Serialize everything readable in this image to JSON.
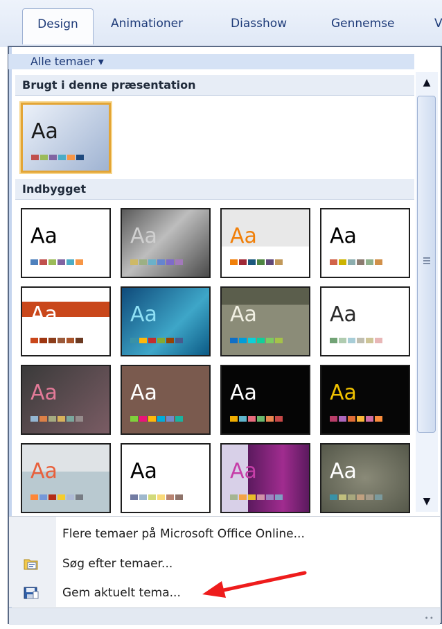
{
  "tabs": [
    {
      "label": "Design",
      "active": true
    },
    {
      "label": "Animationer",
      "active": false
    },
    {
      "label": "Diasshow",
      "active": false
    },
    {
      "label": "Gennemse",
      "active": false
    },
    {
      "label": "V",
      "active": false
    }
  ],
  "filter": {
    "label": "Alle temaer ▾"
  },
  "sections": {
    "used": "Brugt i denne præsentation",
    "builtin": "Indbygget"
  },
  "thumb_text": "Aa",
  "themes_used": [
    {
      "name": "current-theme",
      "bg": "linear-gradient(135deg,#ecf1f9,#9fb3d2)",
      "aa": "#1a1a1a",
      "swatches": [
        "#c0504d",
        "#9bbb59",
        "#8064a2",
        "#4bacc6",
        "#f79646",
        "#1f497d"
      ],
      "selected": true
    }
  ],
  "themes_builtin": [
    {
      "name": "office",
      "bg": "#ffffff",
      "aa": "#000000",
      "swatches": [
        "#4f81bd",
        "#c0504d",
        "#9bbb59",
        "#8064a2",
        "#4bacc6",
        "#f79646"
      ]
    },
    {
      "name": "apex",
      "bg": "linear-gradient(135deg,#5a5a5a,#bdbdbd 45%,#4a4a4a)",
      "aa": "#d0d0d0",
      "swatches": [
        "#ceb966",
        "#9cb084",
        "#6bb1c9",
        "#6585cf",
        "#7e6bc9",
        "#a379bb"
      ]
    },
    {
      "name": "aspect",
      "bg": "linear-gradient(#e8e8e8 55%,#ffffff 55%)",
      "aa": "#f07f09",
      "swatches": [
        "#f07f09",
        "#9f2936",
        "#1b587c",
        "#4e8542",
        "#604878",
        "#c19859"
      ]
    },
    {
      "name": "civic",
      "bg": "#ffffff",
      "aa": "#000000",
      "swatches": [
        "#d16349",
        "#ccb400",
        "#8cadae",
        "#8c7b70",
        "#8fb08c",
        "#d19049"
      ]
    },
    {
      "name": "concourse",
      "bg": "#ffffff",
      "aa": "#ffffff",
      "swatches": [
        "#c9471b",
        "#9e3611",
        "#8c3d1a",
        "#9b5a3a",
        "#a9542b",
        "#6b3a22"
      ],
      "band": "#c9471b"
    },
    {
      "name": "equity",
      "bg": "linear-gradient(135deg,#0f4a7a,#3ea6c8 60%,#0c5a85)",
      "aa": "#8fe0f5",
      "swatches": [
        "#3891a7",
        "#feb80a",
        "#c32d2e",
        "#84aa33",
        "#964305",
        "#475a8d"
      ]
    },
    {
      "name": "flow",
      "bg": "linear-gradient(#5b5e4c 25%,#8b8c78 25%)",
      "aa": "#f0efe2",
      "swatches": [
        "#0f6fc6",
        "#009dd9",
        "#0bd0d9",
        "#10cf9b",
        "#7cca62",
        "#a5c249"
      ]
    },
    {
      "name": "foundry",
      "bg": "#ffffff",
      "aa": "#2b2b2b",
      "swatches": [
        "#72a376",
        "#b0ccb0",
        "#a8cdd7",
        "#c0beaf",
        "#cec597",
        "#e8b7b7"
      ]
    },
    {
      "name": "median",
      "bg": "linear-gradient(135deg,#3a3a3a,#7a5c64)",
      "aa": "#e37a98",
      "swatches": [
        "#94b6d2",
        "#dd8047",
        "#a5ab81",
        "#d8b25c",
        "#7ba79d",
        "#968c8c"
      ]
    },
    {
      "name": "metro",
      "bg": "#7a5a4e",
      "aa": "#ffffff",
      "swatches": [
        "#7fd13b",
        "#ea157a",
        "#feb80a",
        "#00addc",
        "#738ac8",
        "#1ab39f"
      ]
    },
    {
      "name": "module",
      "bg": "#050505",
      "aa": "#ffffff",
      "swatches": [
        "#f0ad00",
        "#60b5cc",
        "#e66c7d",
        "#6bb76d",
        "#e88651",
        "#c64847"
      ]
    },
    {
      "name": "opulent",
      "bg": "#060606",
      "aa": "#f0c200",
      "swatches": [
        "#b83d68",
        "#ac66bb",
        "#de6c36",
        "#f9b639",
        "#cf6da4",
        "#fa8d3d"
      ]
    },
    {
      "name": "oriel",
      "bg": "linear-gradient(#dfe3e6 40%,#b9c9d0 40%)",
      "aa": "#e8603c",
      "swatches": [
        "#fe8637",
        "#7598d9",
        "#b32c16",
        "#f5cd2d",
        "#aebad5",
        "#777c84"
      ]
    },
    {
      "name": "origin",
      "bg": "#ffffff",
      "aa": "#000000",
      "swatches": [
        "#727ca3",
        "#9fb8cd",
        "#d2da7a",
        "#fada7a",
        "#b88472",
        "#8e736a"
      ]
    },
    {
      "name": "paper",
      "bg": "linear-gradient(90deg,#d8d0e8 30%,#5b1a5e 30%,#a02c8f 70%,#5b1a5e)",
      "aa": "#c63ea8",
      "swatches": [
        "#a5b592",
        "#f3a447",
        "#e7bc29",
        "#d092a7",
        "#9c85c0",
        "#809ec2"
      ]
    },
    {
      "name": "solstice",
      "bg": "radial-gradient(#8a8a78,#55584a)",
      "aa": "#ffffff",
      "swatches": [
        "#3891a7",
        "#c0bf7d",
        "#a7a77d",
        "#c0a080",
        "#a59b8a",
        "#7b9a9d"
      ]
    }
  ],
  "menu": [
    {
      "label": "Flere temaer på Microsoft Office Online...",
      "icon": ""
    },
    {
      "label": "Søg efter temaer...",
      "icon": "browse-themes-icon"
    },
    {
      "label": "Gem aktuelt tema...",
      "icon": "save-theme-icon"
    }
  ],
  "annotation_arrow_color": "#ee1c1c"
}
